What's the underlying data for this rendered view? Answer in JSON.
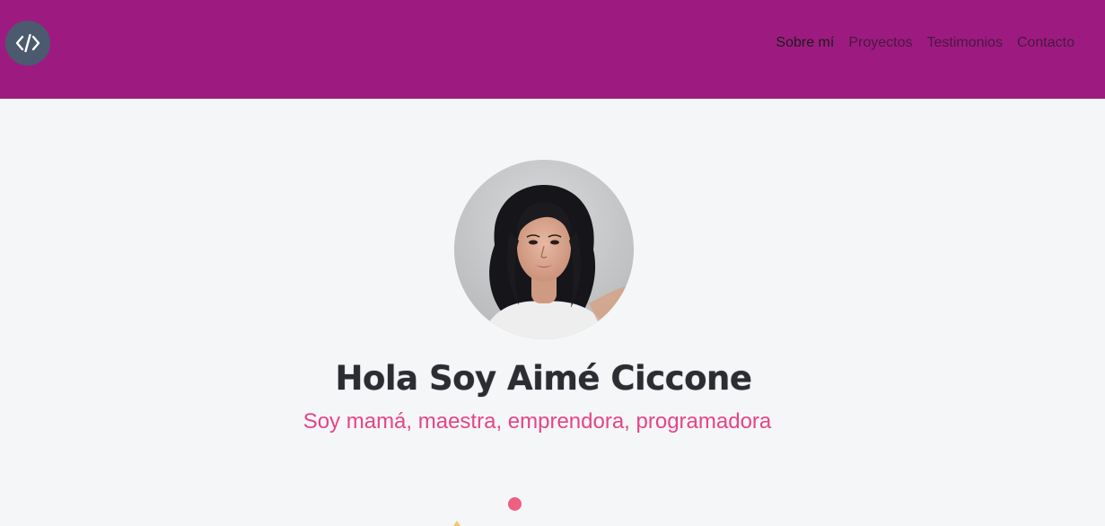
{
  "header": {
    "logo_icon": "code-brackets-icon",
    "nav": [
      {
        "label": "Sobre mí",
        "active": true
      },
      {
        "label": "Proyectos",
        "active": false
      },
      {
        "label": "Testimonios",
        "active": false
      },
      {
        "label": "Contacto",
        "active": false
      }
    ]
  },
  "hero": {
    "avatar_icon": "profile-photo",
    "title": "Hola Soy Aimé Ciccone",
    "subtitle": "Soy mamá, maestra, emprendora, programadora"
  },
  "colors": {
    "navbar": "#9d1b80",
    "logo_bg": "#4b5a6e",
    "background": "#f5f6f8",
    "subtitle": "#e54587",
    "dot": "#ef5f81"
  }
}
